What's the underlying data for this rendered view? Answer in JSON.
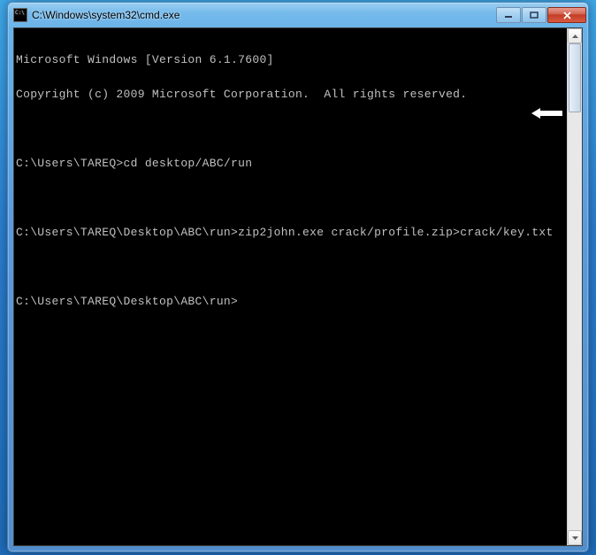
{
  "window": {
    "title": "C:\\Windows\\system32\\cmd.exe"
  },
  "terminal": {
    "lines": [
      "Microsoft Windows [Version 6.1.7600]",
      "Copyright (c) 2009 Microsoft Corporation.  All rights reserved.",
      "",
      "C:\\Users\\TAREQ>cd desktop/ABC/run",
      "",
      "C:\\Users\\TAREQ\\Desktop\\ABC\\run>zip2john.exe crack/profile.zip>crack/key.txt",
      "",
      "C:\\Users\\TAREQ\\Desktop\\ABC\\run>"
    ]
  }
}
